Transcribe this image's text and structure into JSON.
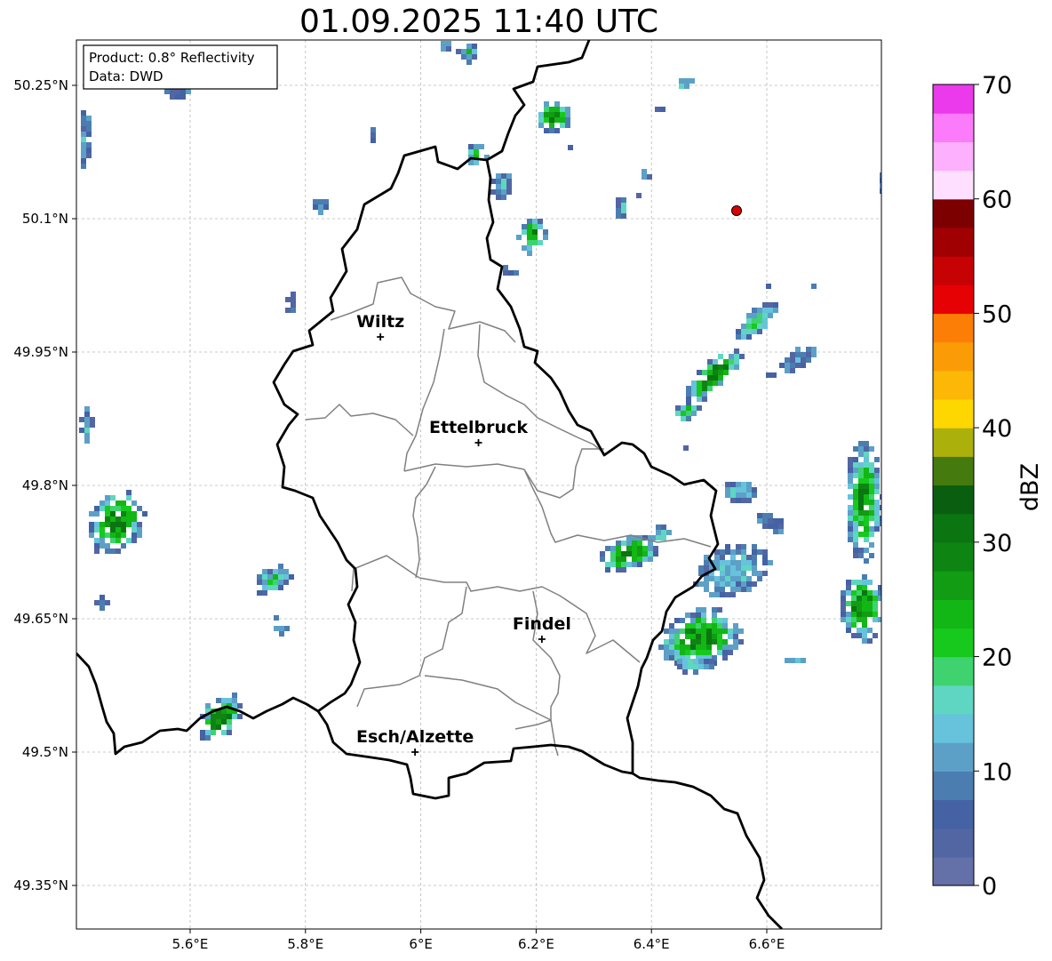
{
  "title": "01.09.2025 11:40 UTC",
  "info_box": {
    "product": "Product: 0.8° Reflectivity",
    "data_source": "Data: DWD"
  },
  "map": {
    "lon_ticks": [
      "5.6°E",
      "5.8°E",
      "6°E",
      "6.2°E",
      "6.4°E",
      "6.6°E"
    ],
    "lat_ticks": [
      "50.25°N",
      "50.1°N",
      "49.95°N",
      "49.8°N",
      "49.65°N",
      "49.5°N",
      "49.35°N"
    ],
    "cities": [
      {
        "name": "Wiltz",
        "lon": 5.93,
        "lat": 49.967
      },
      {
        "name": "Ettelbruck",
        "lon": 6.1,
        "lat": 49.848
      },
      {
        "name": "Findel",
        "lon": 6.21,
        "lat": 49.627
      },
      {
        "name": "Esch/Alzette",
        "lon": 5.99,
        "lat": 49.5
      }
    ],
    "marker_red_dot": {
      "lon": 6.55,
      "lat": 50.11,
      "color": "#dd0000"
    }
  },
  "colorbar": {
    "label": "dBZ",
    "tick_labels": [
      "0",
      "10",
      "20",
      "30",
      "40",
      "50",
      "60",
      "70"
    ],
    "colors": [
      "#6471a8",
      "#5166a3",
      "#4462a4",
      "#4b7db1",
      "#5ca0c8",
      "#67c2dc",
      "#5fd6c2",
      "#3ed36e",
      "#16c91c",
      "#12b615",
      "#119c13",
      "#0e8512",
      "#0b7511",
      "#0a5e10",
      "#447a0e",
      "#acb00a",
      "#fed700",
      "#fdb807",
      "#fb9c06",
      "#fc7e06",
      "#e60104",
      "#c60205",
      "#a10003",
      "#7d0001",
      "#fedfff",
      "#fdb0fe",
      "#fc7bfb",
      "#ea3aeb"
    ]
  }
}
